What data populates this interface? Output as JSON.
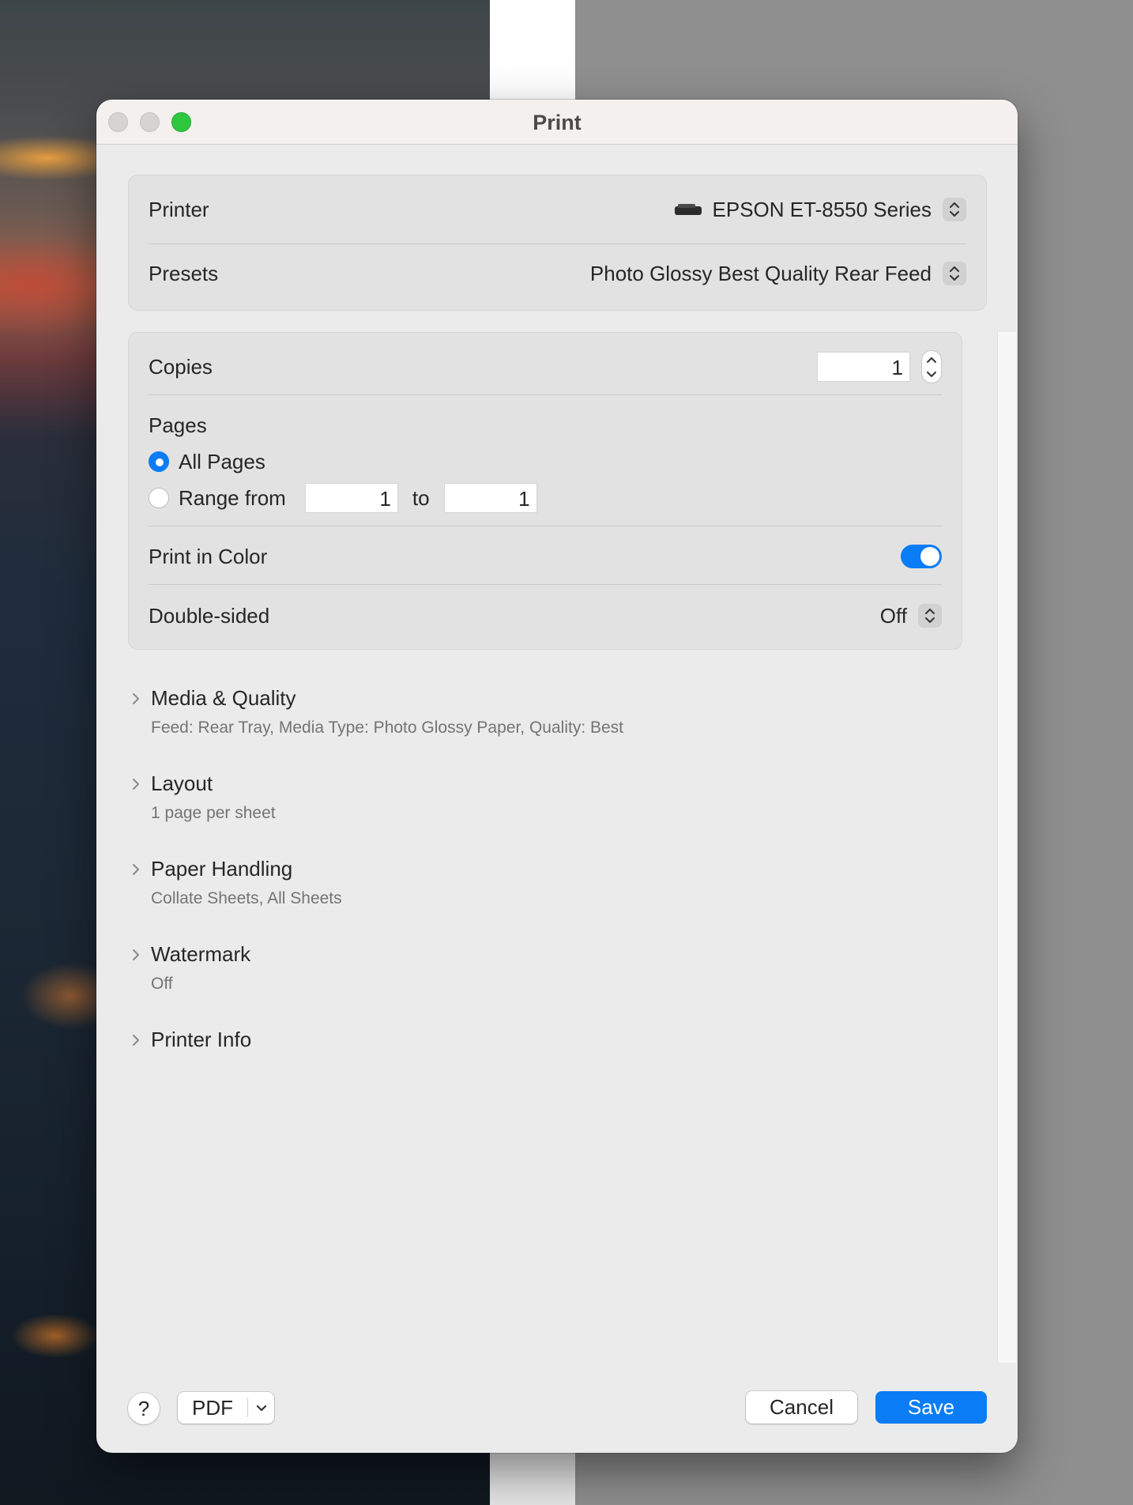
{
  "window": {
    "title": "Print"
  },
  "printer_panel": {
    "printer_label": "Printer",
    "printer_value": "EPSON ET-8550 Series",
    "presets_label": "Presets",
    "presets_value": "Photo Glossy Best Quality Rear Feed"
  },
  "options_panel": {
    "copies_label": "Copies",
    "copies_value": "1",
    "pages_label": "Pages",
    "all_pages_label": "All Pages",
    "all_pages_selected": true,
    "range_from_label": "Range from",
    "range_from_value": "1",
    "range_to_label": "to",
    "range_to_value": "1",
    "print_in_color_label": "Print in Color",
    "print_in_color_on": true,
    "double_sided_label": "Double-sided",
    "double_sided_value": "Off"
  },
  "sections": [
    {
      "title": "Media & Quality",
      "summary": "Feed: Rear Tray, Media Type: Photo Glossy Paper, Quality: Best"
    },
    {
      "title": "Layout",
      "summary": "1 page per sheet"
    },
    {
      "title": "Paper Handling",
      "summary": "Collate Sheets, All Sheets"
    },
    {
      "title": "Watermark",
      "summary": "Off"
    },
    {
      "title": "Printer Info",
      "summary": ""
    }
  ],
  "footer": {
    "help_label": "?",
    "pdf_label": "PDF",
    "cancel_label": "Cancel",
    "save_label": "Save"
  },
  "colors": {
    "accent": "#0a7cf6",
    "traffic_light_max": "#2dc840"
  }
}
